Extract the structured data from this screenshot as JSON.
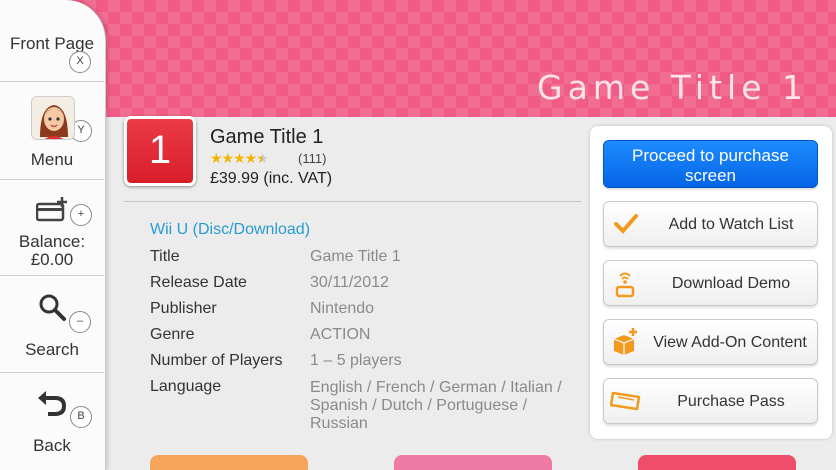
{
  "banner": {
    "title": "Game Title 1"
  },
  "sidebar": {
    "front_page": {
      "label": "Front Page",
      "key": "X"
    },
    "menu": {
      "label": "Menu",
      "key": "Y"
    },
    "balance": {
      "label": "Balance:",
      "value": "£0.00",
      "key": "+"
    },
    "search": {
      "label": "Search",
      "key": "–"
    },
    "back": {
      "label": "Back",
      "key": "B"
    }
  },
  "game": {
    "icon_text": "1",
    "name": "Game Title 1",
    "stars": "★★★★",
    "half_star": "★",
    "rating_count": "(111)",
    "price": "£39.99 (inc. VAT)"
  },
  "details": {
    "platform": "Wii U (Disc/Download)",
    "rows": [
      {
        "label": "Title",
        "value": "Game Title 1"
      },
      {
        "label": "Release Date",
        "value": "30/11/2012"
      },
      {
        "label": "Publisher",
        "value": "Nintendo"
      },
      {
        "label": "Genre",
        "value": "ACTION"
      },
      {
        "label": "Number of Players",
        "value": "1 – 5 players"
      },
      {
        "label": "Language",
        "value_lines": [
          "English / French / German / Italian /",
          "Spanish / Dutch / Portuguese /",
          "Russian"
        ]
      }
    ]
  },
  "actions": {
    "purchase_line1": "Proceed to purchase",
    "purchase_line2": "screen",
    "watch_list": "Add to Watch List",
    "download_demo": "Download Demo",
    "add_on": "View Add-On Content",
    "purchase_pass": "Purchase Pass"
  },
  "colors": {
    "banner": "#f05c86",
    "primary_button": "#0564e6",
    "platform_link": "#2a9bd1",
    "accent_orange": "#f39a1d",
    "bottom_tab_1": "#f5a55a",
    "bottom_tab_2": "#f07aa6",
    "bottom_tab_3": "#ef4e6a"
  },
  "icons": {
    "front_page": "",
    "menu": "mii-avatar",
    "balance": "wallet-plus-icon",
    "search": "magnifier-icon",
    "back": "back-arrow-icon",
    "watch_list": "checkmark-icon",
    "download_demo": "download-icon",
    "add_on": "package-plus-icon",
    "purchase_pass": "ticket-icon"
  }
}
